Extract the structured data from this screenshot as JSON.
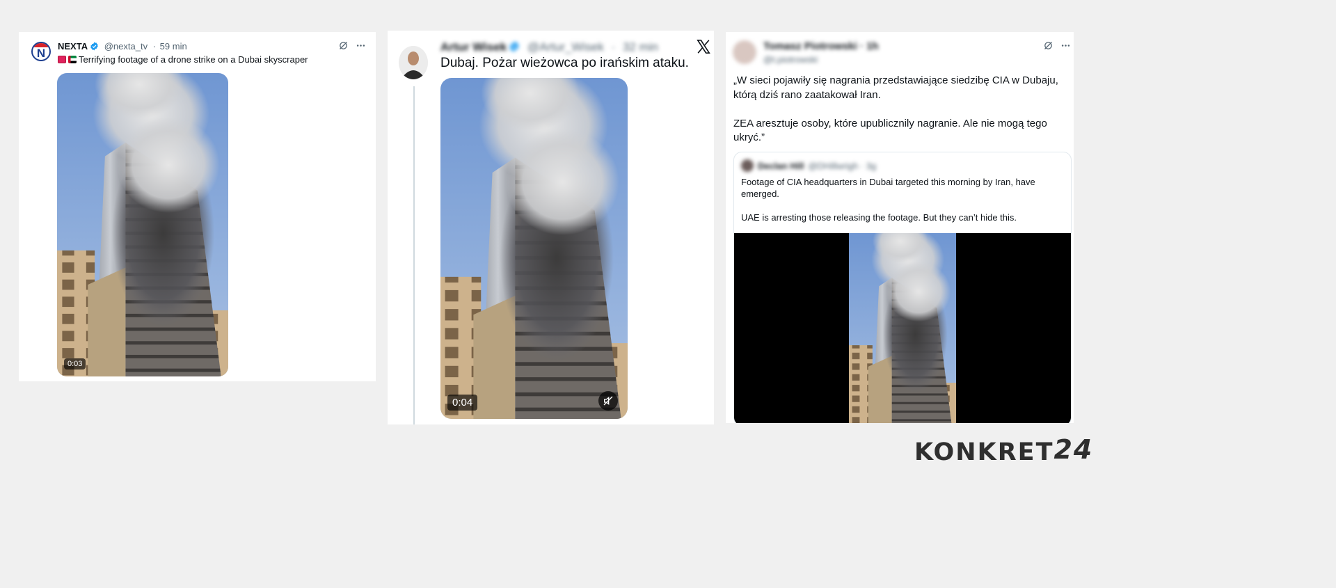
{
  "colors": {
    "page_bg": "#f0f0f0",
    "card_bg": "#ffffff",
    "verified_blue": "#1d9bf0",
    "secondary_text": "#536471",
    "logo_dark": "#2f2f2f"
  },
  "post1": {
    "author_name": "NEXTA",
    "handle": "@nexta_tv",
    "separator": "·",
    "time": "59 min",
    "text": "Terrifying footage of a drone strike on a Dubai skyscraper",
    "emoji_icons": [
      "red-badge-emoji",
      "uae-flag-emoji"
    ],
    "video_duration": "0:03",
    "action_icons": [
      "grok-icon",
      "more-icon"
    ]
  },
  "post2": {
    "author_name": "Artur Wisek",
    "handle": "@Artur_Wisek",
    "separator": "·",
    "time": "32 min",
    "text": "Dubaj. Pożar wieżowca po irańskim ataku.",
    "video_duration": "0:04",
    "platform_icon": "x-logo-icon",
    "media_icon": "muted-speaker-icon"
  },
  "post3": {
    "author_name": "Tomasz Piotrowski · 1h",
    "handle": "@t.piotrowski",
    "paragraph_1": "„W sieci pojawiły się nagrania przedstawiające siedzibę CIA w Dubaju, którą dziś rano zaatakował Iran.",
    "paragraph_2": "ZEA aresztuje osoby, które upublicznily nagranie. Ale nie mogą tego ukryć.”",
    "action_icons": [
      "grok-icon",
      "more-icon"
    ],
    "quote": {
      "author_name": "Declan Hill",
      "handle": "@DHillwrigh · 3g",
      "paragraph_1": "Footage of CIA headquarters in Dubai targeted this morning by Iran, have emerged.",
      "paragraph_2": "UAE is arresting those releasing the footage. But they can’t hide this."
    }
  },
  "logo": {
    "text": "KONKRET",
    "number": "24"
  }
}
